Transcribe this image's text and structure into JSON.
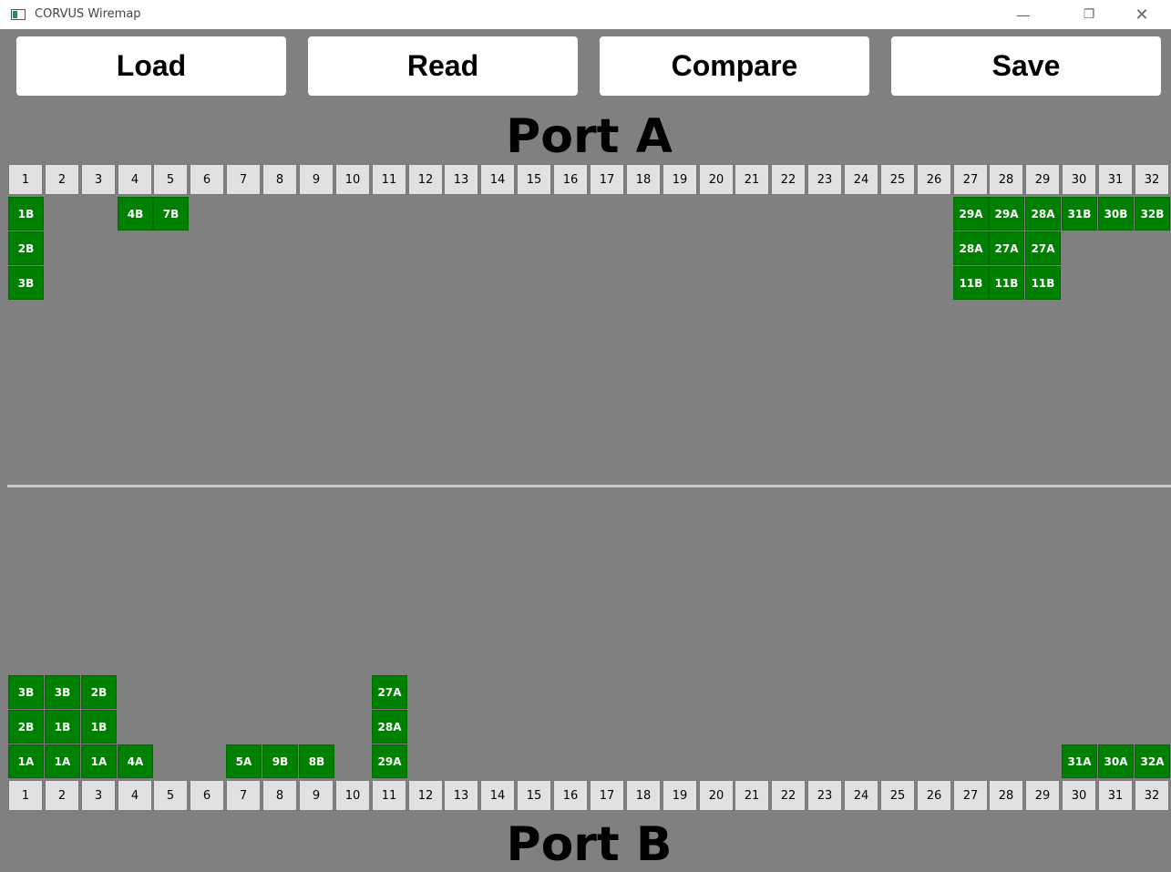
{
  "window": {
    "title": "CORVUS Wiremap",
    "minimize_glyph": "—",
    "restore_glyph": "❐",
    "close_glyph": "✕"
  },
  "toolbar": {
    "load_label": "Load",
    "read_label": "Read",
    "compare_label": "Compare",
    "save_label": "Save"
  },
  "port_a": {
    "title": "Port A",
    "columns": [
      {
        "number": "1",
        "cells": [
          "1B",
          "2B",
          "3B"
        ]
      },
      {
        "number": "2",
        "cells": []
      },
      {
        "number": "3",
        "cells": []
      },
      {
        "number": "4",
        "cells": [
          "4B"
        ]
      },
      {
        "number": "5",
        "cells": [
          "7B"
        ]
      },
      {
        "number": "6",
        "cells": []
      },
      {
        "number": "7",
        "cells": []
      },
      {
        "number": "8",
        "cells": []
      },
      {
        "number": "9",
        "cells": []
      },
      {
        "number": "10",
        "cells": []
      },
      {
        "number": "11",
        "cells": []
      },
      {
        "number": "12",
        "cells": []
      },
      {
        "number": "13",
        "cells": []
      },
      {
        "number": "14",
        "cells": []
      },
      {
        "number": "15",
        "cells": []
      },
      {
        "number": "16",
        "cells": []
      },
      {
        "number": "17",
        "cells": []
      },
      {
        "number": "18",
        "cells": []
      },
      {
        "number": "19",
        "cells": []
      },
      {
        "number": "20",
        "cells": []
      },
      {
        "number": "21",
        "cells": []
      },
      {
        "number": "22",
        "cells": []
      },
      {
        "number": "23",
        "cells": []
      },
      {
        "number": "24",
        "cells": []
      },
      {
        "number": "25",
        "cells": []
      },
      {
        "number": "26",
        "cells": []
      },
      {
        "number": "27",
        "cells": [
          "29A",
          "28A",
          "11B"
        ]
      },
      {
        "number": "28",
        "cells": [
          "29A",
          "27A",
          "11B"
        ]
      },
      {
        "number": "29",
        "cells": [
          "28A",
          "27A",
          "11B"
        ]
      },
      {
        "number": "30",
        "cells": [
          "31B"
        ]
      },
      {
        "number": "31",
        "cells": [
          "30B"
        ]
      },
      {
        "number": "32",
        "cells": [
          "32B"
        ]
      }
    ]
  },
  "port_b": {
    "title": "Port B",
    "columns": [
      {
        "number": "1",
        "cells": [
          "1A",
          "2B",
          "3B"
        ]
      },
      {
        "number": "2",
        "cells": [
          "1A",
          "1B",
          "3B"
        ]
      },
      {
        "number": "3",
        "cells": [
          "1A",
          "1B",
          "2B"
        ]
      },
      {
        "number": "4",
        "cells": [
          "4A"
        ]
      },
      {
        "number": "5",
        "cells": []
      },
      {
        "number": "6",
        "cells": []
      },
      {
        "number": "7",
        "cells": [
          "5A"
        ]
      },
      {
        "number": "8",
        "cells": [
          "9B"
        ]
      },
      {
        "number": "9",
        "cells": [
          "8B"
        ]
      },
      {
        "number": "10",
        "cells": []
      },
      {
        "number": "11",
        "cells": [
          "29A",
          "28A",
          "27A"
        ]
      },
      {
        "number": "12",
        "cells": []
      },
      {
        "number": "13",
        "cells": []
      },
      {
        "number": "14",
        "cells": []
      },
      {
        "number": "15",
        "cells": []
      },
      {
        "number": "16",
        "cells": []
      },
      {
        "number": "17",
        "cells": []
      },
      {
        "number": "18",
        "cells": []
      },
      {
        "number": "19",
        "cells": []
      },
      {
        "number": "20",
        "cells": []
      },
      {
        "number": "21",
        "cells": []
      },
      {
        "number": "22",
        "cells": []
      },
      {
        "number": "23",
        "cells": []
      },
      {
        "number": "24",
        "cells": []
      },
      {
        "number": "25",
        "cells": []
      },
      {
        "number": "26",
        "cells": []
      },
      {
        "number": "27",
        "cells": []
      },
      {
        "number": "28",
        "cells": []
      },
      {
        "number": "29",
        "cells": []
      },
      {
        "number": "30",
        "cells": [
          "31A"
        ]
      },
      {
        "number": "31",
        "cells": [
          "30A"
        ]
      },
      {
        "number": "32",
        "cells": [
          "32A"
        ]
      }
    ]
  },
  "colors": {
    "background": "#808080",
    "cell_green": "#008000",
    "header_cell": "#e1e1e1"
  }
}
